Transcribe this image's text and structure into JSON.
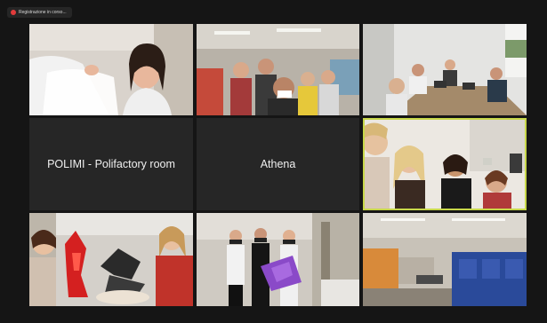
{
  "recording": {
    "label": "Registrazione in corso..."
  },
  "tiles": [
    {
      "kind": "video",
      "name": "participant-1-video"
    },
    {
      "kind": "video",
      "name": "participant-2-video"
    },
    {
      "kind": "video",
      "name": "participant-3-video"
    },
    {
      "kind": "name",
      "label": "POLIMI - Polifactory room"
    },
    {
      "kind": "name",
      "label": "Athena"
    },
    {
      "kind": "video",
      "name": "participant-4-video",
      "active": true
    },
    {
      "kind": "video",
      "name": "participant-5-video"
    },
    {
      "kind": "video",
      "name": "participant-6-video"
    },
    {
      "kind": "video",
      "name": "participant-7-video"
    }
  ],
  "colors": {
    "background": "#151515",
    "active_speaker": "#c8d84a",
    "recording_dot": "#e23b3b",
    "name_tile": "#262626"
  }
}
